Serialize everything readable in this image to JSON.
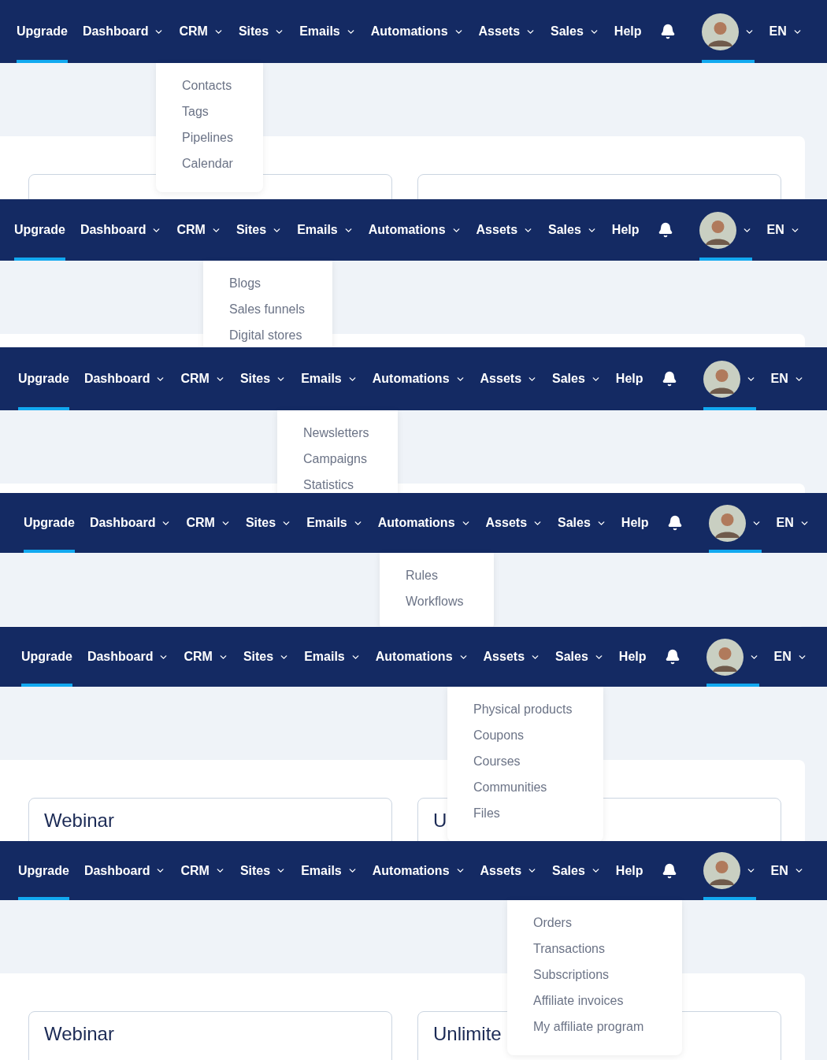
{
  "panels": [
    {
      "nav": [
        {
          "kind": "link",
          "label": "Upgrade",
          "selected": true
        },
        {
          "kind": "dropdown",
          "label": "Dashboard",
          "selected": false
        },
        {
          "kind": "dropdown",
          "label": "CRM",
          "selected": false
        },
        {
          "kind": "dropdown",
          "label": "Sites",
          "selected": false
        },
        {
          "kind": "dropdown",
          "label": "Emails",
          "selected": false
        },
        {
          "kind": "dropdown",
          "label": "Automations",
          "selected": false
        },
        {
          "kind": "dropdown",
          "label": "Assets",
          "selected": false
        },
        {
          "kind": "dropdown",
          "label": "Sales",
          "selected": false
        },
        {
          "kind": "link",
          "label": "Help",
          "selected": false
        },
        {
          "kind": "bell",
          "selected": false
        },
        {
          "kind": "avatar",
          "selected": true
        },
        {
          "kind": "dropdown",
          "label": "EN",
          "selected": false
        }
      ],
      "menu": [
        "Contacts",
        "Tags",
        "Pipelines",
        "Calendar"
      ]
    },
    {
      "nav": [
        {
          "kind": "link",
          "label": "Upgrade",
          "selected": true
        },
        {
          "kind": "dropdown",
          "label": "Dashboard",
          "selected": false
        },
        {
          "kind": "dropdown",
          "label": "CRM",
          "selected": false
        },
        {
          "kind": "dropdown",
          "label": "Sites",
          "selected": false
        },
        {
          "kind": "dropdown",
          "label": "Emails",
          "selected": false
        },
        {
          "kind": "dropdown",
          "label": "Automations",
          "selected": false
        },
        {
          "kind": "dropdown",
          "label": "Assets",
          "selected": false
        },
        {
          "kind": "dropdown",
          "label": "Sales",
          "selected": false
        },
        {
          "kind": "link",
          "label": "Help",
          "selected": false
        },
        {
          "kind": "bell",
          "selected": false
        },
        {
          "kind": "avatar",
          "selected": true
        },
        {
          "kind": "dropdown",
          "label": "EN",
          "selected": false
        }
      ],
      "menu": [
        "Blogs",
        "Sales funnels",
        "Digital stores"
      ]
    },
    {
      "nav": [
        {
          "kind": "link",
          "label": "Upgrade",
          "selected": true
        },
        {
          "kind": "dropdown",
          "label": "Dashboard",
          "selected": false
        },
        {
          "kind": "dropdown",
          "label": "CRM",
          "selected": false
        },
        {
          "kind": "dropdown",
          "label": "Sites",
          "selected": false
        },
        {
          "kind": "dropdown",
          "label": "Emails",
          "selected": false
        },
        {
          "kind": "dropdown",
          "label": "Automations",
          "selected": false
        },
        {
          "kind": "dropdown",
          "label": "Assets",
          "selected": false
        },
        {
          "kind": "dropdown",
          "label": "Sales",
          "selected": false
        },
        {
          "kind": "link",
          "label": "Help",
          "selected": false
        },
        {
          "kind": "bell",
          "selected": false
        },
        {
          "kind": "avatar",
          "selected": true
        },
        {
          "kind": "dropdown",
          "label": "EN",
          "selected": false
        }
      ],
      "menu": [
        "Newsletters",
        "Campaigns",
        "Statistics"
      ]
    },
    {
      "nav": [
        {
          "kind": "link",
          "label": "Upgrade",
          "selected": true
        },
        {
          "kind": "dropdown",
          "label": "Dashboard",
          "selected": false
        },
        {
          "kind": "dropdown",
          "label": "CRM",
          "selected": false
        },
        {
          "kind": "dropdown",
          "label": "Sites",
          "selected": false
        },
        {
          "kind": "dropdown",
          "label": "Emails",
          "selected": false
        },
        {
          "kind": "dropdown",
          "label": "Automations",
          "selected": false
        },
        {
          "kind": "dropdown",
          "label": "Assets",
          "selected": false
        },
        {
          "kind": "dropdown",
          "label": "Sales",
          "selected": false
        },
        {
          "kind": "link",
          "label": "Help",
          "selected": false
        },
        {
          "kind": "bell",
          "selected": false
        },
        {
          "kind": "avatar",
          "selected": true
        },
        {
          "kind": "dropdown",
          "label": "EN",
          "selected": false
        }
      ],
      "menu": [
        "Rules",
        "Workflows"
      ]
    },
    {
      "nav": [
        {
          "kind": "link",
          "label": "Upgrade",
          "selected": true
        },
        {
          "kind": "dropdown",
          "label": "Dashboard",
          "selected": false
        },
        {
          "kind": "dropdown",
          "label": "CRM",
          "selected": false
        },
        {
          "kind": "dropdown",
          "label": "Sites",
          "selected": false
        },
        {
          "kind": "dropdown",
          "label": "Emails",
          "selected": false
        },
        {
          "kind": "dropdown",
          "label": "Automations",
          "selected": false
        },
        {
          "kind": "dropdown",
          "label": "Assets",
          "selected": false
        },
        {
          "kind": "dropdown",
          "label": "Sales",
          "selected": false
        },
        {
          "kind": "link",
          "label": "Help",
          "selected": false
        },
        {
          "kind": "bell",
          "selected": false
        },
        {
          "kind": "avatar",
          "selected": true
        },
        {
          "kind": "dropdown",
          "label": "EN",
          "selected": false
        }
      ],
      "menu": [
        "Physical products",
        "Coupons",
        "Courses",
        "Communities",
        "Files"
      ],
      "tiles": [
        "Webinar",
        "U"
      ]
    },
    {
      "nav": [
        {
          "kind": "link",
          "label": "Upgrade",
          "selected": true
        },
        {
          "kind": "dropdown",
          "label": "Dashboard",
          "selected": false
        },
        {
          "kind": "dropdown",
          "label": "CRM",
          "selected": false
        },
        {
          "kind": "dropdown",
          "label": "Sites",
          "selected": false
        },
        {
          "kind": "dropdown",
          "label": "Emails",
          "selected": false
        },
        {
          "kind": "dropdown",
          "label": "Automations",
          "selected": false
        },
        {
          "kind": "dropdown",
          "label": "Assets",
          "selected": false
        },
        {
          "kind": "dropdown",
          "label": "Sales",
          "selected": false
        },
        {
          "kind": "link",
          "label": "Help",
          "selected": false
        },
        {
          "kind": "bell",
          "selected": false
        },
        {
          "kind": "avatar",
          "selected": true
        },
        {
          "kind": "dropdown",
          "label": "EN",
          "selected": false
        }
      ],
      "menu": [
        "Orders",
        "Transactions",
        "Subscriptions",
        "Affiliate invoices",
        "My affiliate program"
      ],
      "tiles": [
        "Webinar",
        "Unlimite"
      ]
    }
  ]
}
